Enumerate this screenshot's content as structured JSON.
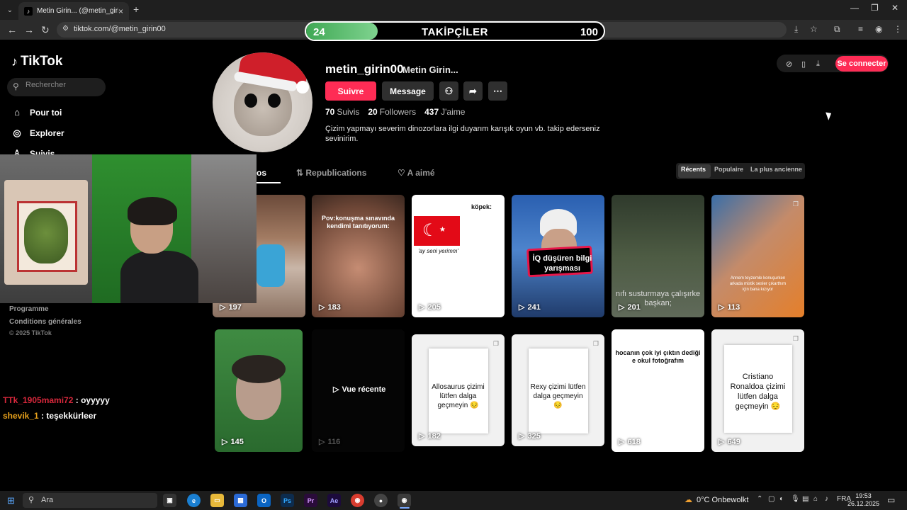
{
  "browser": {
    "tab_title": "Metin Girin... (@metin_girin00)",
    "url": "tiktok.com/@metin_girin00"
  },
  "overlay": {
    "title": "TAKİPÇİLER",
    "current": "24",
    "goal": "100",
    "progress": 0.24
  },
  "sidebar": {
    "logo": "TikTok",
    "search_placeholder": "Rechercher",
    "nav": [
      "Pour toi",
      "Explorer",
      "Suivis"
    ],
    "footer": [
      "Programme",
      "Conditions générales"
    ],
    "copyright": "© 2025 TikTok"
  },
  "chat": [
    {
      "user": "TTk_1905mami72",
      "message": ": oyyyyy"
    },
    {
      "user": "shevik_1",
      "message": ": teşekkürleer"
    }
  ],
  "profile": {
    "username": "metin_girin00",
    "nickname": "Metin Girin...",
    "follow_label": "Suivre",
    "message_label": "Message",
    "stats": [
      {
        "num": "70",
        "label": "Suivis"
      },
      {
        "num": "20",
        "label": "Followers"
      },
      {
        "num": "437",
        "label": "J'aime"
      }
    ],
    "bio": "Çizim yapmayı severim dinozorlara ilgi duyarım karışık oyun vb. takip ederseniz sevinirim."
  },
  "tabs": {
    "videos_partial": "os",
    "reposts": "Republications",
    "liked": "A aimé"
  },
  "sort": [
    "Récents",
    "Populaire",
    "La plus ancienne"
  ],
  "header_right": {
    "login": "Se connecter"
  },
  "videos": [
    {
      "views": "197"
    },
    {
      "views": "183",
      "caption": "Pov:konuşma sınavında kendimi tanıtıyorum:"
    },
    {
      "views": "205",
      "caption": "köpek:",
      "subcaption": "'ay seni yerimm'"
    },
    {
      "views": "241",
      "caption": "İQ düşüren bilgi yarışması"
    },
    {
      "views": "201",
      "caption": "nıfı susturmaya çalışırke başkan;"
    },
    {
      "views": "113",
      "caption": "Annem teyzemle konuşurken arkada mistik sesler çıkarthım için bana kızıyor"
    },
    {
      "views": "145"
    },
    {
      "views": "116",
      "label": "Vue récente"
    },
    {
      "views": "182",
      "caption": "Allosaurus çizimi lütfen dalga geçmeyin 😔"
    },
    {
      "views": "325",
      "caption": "Rexy çizimi lütfen dalga geçmeyin 😔"
    },
    {
      "views": "618",
      "caption": "hocanın çok iyi çıktın dediği e okul fotoğrafım"
    },
    {
      "views": "649",
      "caption": "Cristiano Ronaldoa çizimi lütfen dalga geçmeyin 😔"
    }
  ],
  "taskbar": {
    "search_placeholder": "Ara",
    "weather": "0°C  Onbewolkt",
    "lang": "FRA",
    "time": "19:53",
    "date": "26.12.2025"
  },
  "colors": {
    "accent": "#fe2c55",
    "progress": "#4fbf63"
  }
}
